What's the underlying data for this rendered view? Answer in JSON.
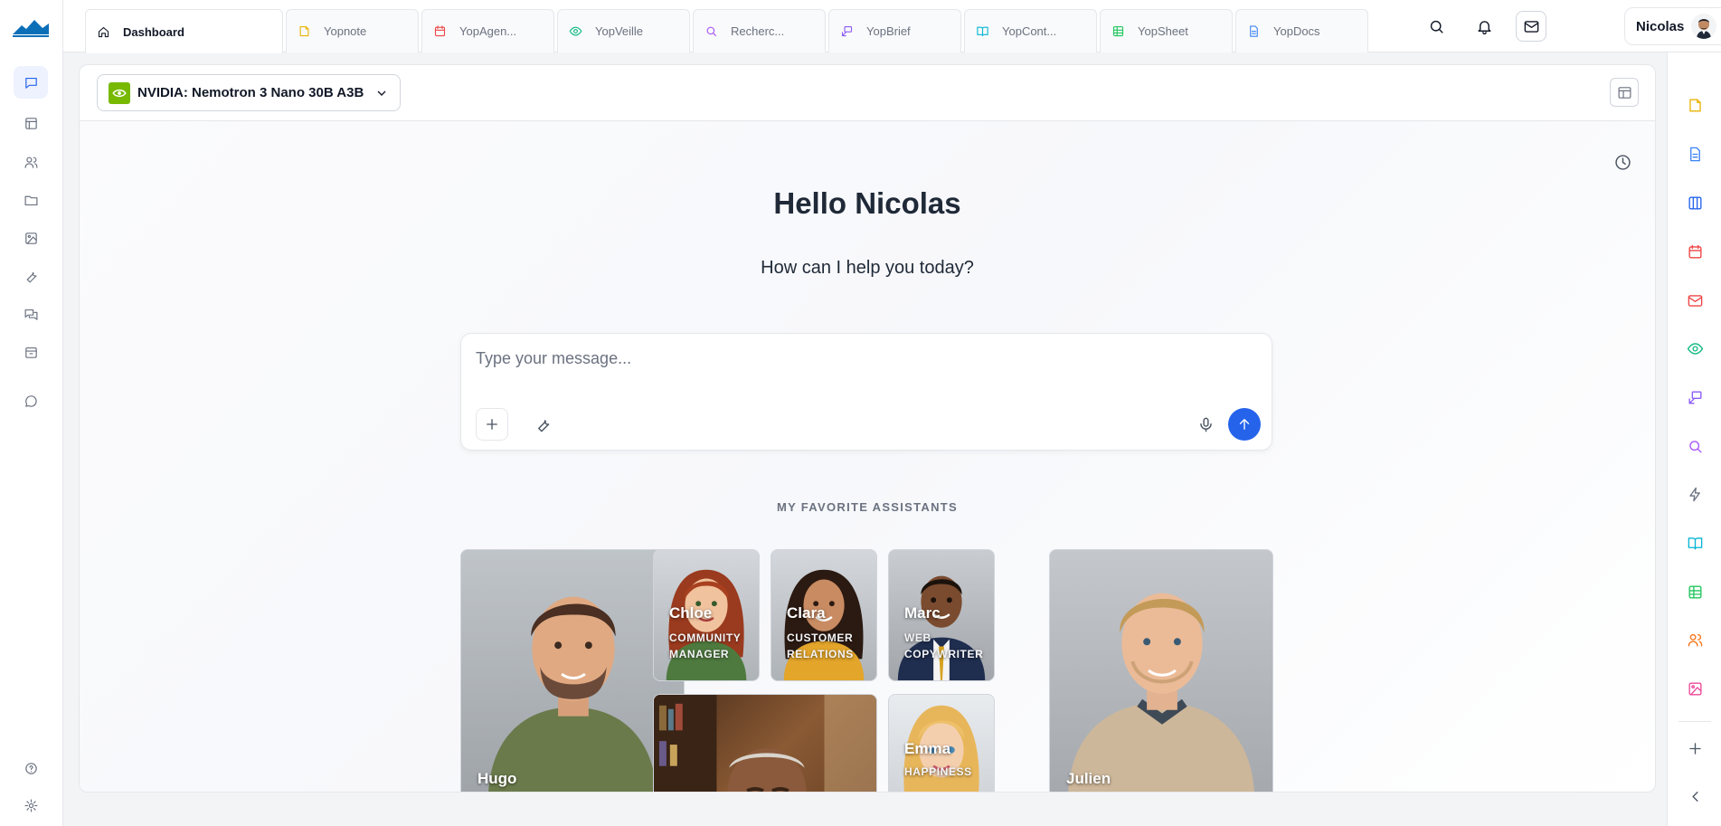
{
  "tabs": [
    {
      "label": "Dashboard",
      "icon": "home-icon"
    },
    {
      "label": "Yopnote",
      "icon": "note-icon"
    },
    {
      "label": "YopAgen...",
      "icon": "calendar-icon"
    },
    {
      "label": "YopVeille",
      "icon": "eye-icon"
    },
    {
      "label": "Recherc...",
      "icon": "search-icon"
    },
    {
      "label": "YopBrief",
      "icon": "brief-icon"
    },
    {
      "label": "YopCont...",
      "icon": "book-icon"
    },
    {
      "label": "YopSheet",
      "icon": "sheet-icon"
    },
    {
      "label": "YopDocs",
      "icon": "doc-icon"
    }
  ],
  "user": {
    "name": "Nicolas"
  },
  "model": {
    "label": "NVIDIA: Nemotron 3 Nano 30B A3B",
    "brand_color": "#76b900"
  },
  "hero": {
    "title": "Hello Nicolas",
    "subtitle": "How can I help you today?"
  },
  "composer": {
    "placeholder": "Type your message...",
    "value": ""
  },
  "favorites": {
    "title": "MY FAVORITE ASSISTANTS",
    "assistants": [
      {
        "name": "Hugo",
        "role": ""
      },
      {
        "name": "Chloe",
        "role": "COMMUNITY MANAGER"
      },
      {
        "name": "Clara",
        "role": "CUSTOMER RELATIONS"
      },
      {
        "name": "Marc",
        "role": "WEB COPYWRITER"
      },
      {
        "name": "Julien",
        "role": ""
      },
      {
        "name": "",
        "role": ""
      },
      {
        "name": "Emma",
        "role": "HAPPINESS"
      }
    ]
  },
  "colors": {
    "accent": "#2563eb",
    "background": "#f3f4f6"
  }
}
